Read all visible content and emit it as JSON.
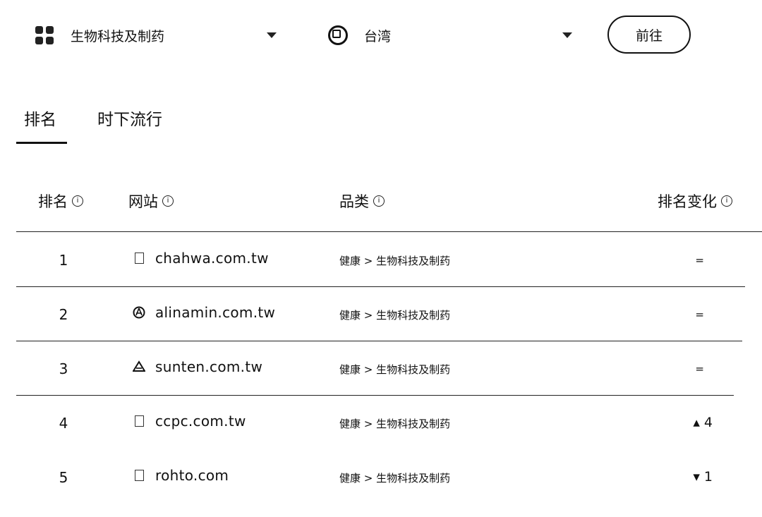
{
  "filters": {
    "industry": {
      "label": "生物科技及制药",
      "icon": "grid-icon"
    },
    "country": {
      "label": "台湾",
      "icon": "globe-icon"
    },
    "go_button": "前往"
  },
  "tabs": [
    {
      "label": "排名",
      "active": true
    },
    {
      "label": "时下流行",
      "active": false
    }
  ],
  "table": {
    "headers": {
      "rank": "排名",
      "website": "网站",
      "category": "品类",
      "change": "排名变化"
    },
    "info_icon": "ⓘ",
    "rows": [
      {
        "rank": "1",
        "site": "chahwa.com.tw",
        "favicon": "page-icon",
        "category": "健康 > 生物科技及制药",
        "change": "="
      },
      {
        "rank": "2",
        "site": "alinamin.com.tw",
        "favicon": "circle-logo-icon",
        "category": "健康 > 生物科技及制药",
        "change": "="
      },
      {
        "rank": "3",
        "site": "sunten.com.tw",
        "favicon": "triangle-logo-icon",
        "category": "健康 > 生物科技及制药",
        "change": "="
      },
      {
        "rank": "4",
        "site": "ccpc.com.tw",
        "favicon": "page-icon",
        "category": "健康 > 生物科技及制药",
        "change": "▴ 4"
      },
      {
        "rank": "5",
        "site": "rohto.com",
        "favicon": "page-icon",
        "category": "健康 > 生物科技及制药",
        "change": "▾ 1"
      }
    ]
  }
}
